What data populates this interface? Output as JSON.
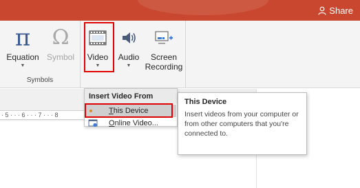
{
  "titlebar": {
    "share_label": "Share",
    "color": "#c9472e"
  },
  "ribbon": {
    "symbols_group": {
      "label": "Symbols",
      "equation": {
        "label": "Equation",
        "icon": "pi-icon",
        "glyph": "π"
      },
      "symbol": {
        "label": "Symbol",
        "icon": "omega-icon",
        "glyph": "Ω"
      }
    },
    "media_group": {
      "video": {
        "label": "Video",
        "icon": "film-icon"
      },
      "audio": {
        "label": "Audio",
        "icon": "speaker-icon"
      },
      "screen_recording": {
        "label_line1": "Screen",
        "label_line2": "Recording",
        "icon": "screen-record-icon"
      }
    }
  },
  "ruler": {
    "text": "· 5 · · · 6 · · · 7 · · · 8"
  },
  "menu": {
    "header": "Insert Video From",
    "items": [
      {
        "label": "This Device",
        "icon": "this-device-icon",
        "selected": true
      },
      {
        "label": "Online Video...",
        "icon": "online-video-icon",
        "selected": false
      }
    ]
  },
  "tooltip": {
    "title": "This Device",
    "body": "Insert videos from your computer or from other computers that you're connected to."
  },
  "highlight_color": "#e00000"
}
